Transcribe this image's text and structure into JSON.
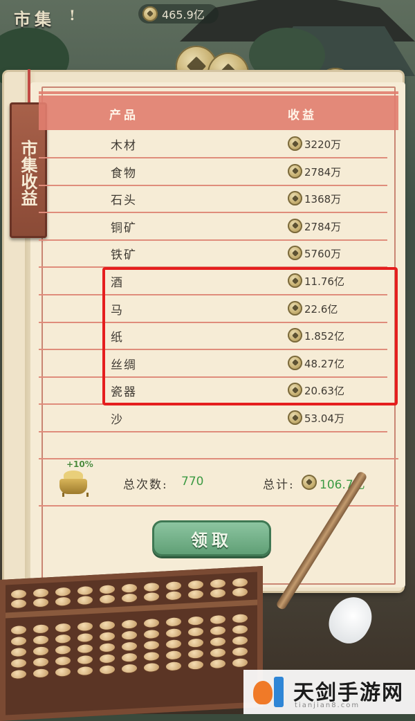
{
  "top": {
    "title": "市集",
    "help": "!",
    "currency": "465.9亿"
  },
  "tag": {
    "label": "市集收益"
  },
  "table": {
    "header_product": "产品",
    "header_income": "收益",
    "rows": [
      {
        "name": "木材",
        "value": "3220万"
      },
      {
        "name": "食物",
        "value": "2784万"
      },
      {
        "name": "石头",
        "value": "1368万"
      },
      {
        "name": "铜矿",
        "value": "2784万"
      },
      {
        "name": "铁矿",
        "value": "5760万"
      },
      {
        "name": "酒",
        "value": "11.76亿"
      },
      {
        "name": "马",
        "value": "22.6亿"
      },
      {
        "name": "纸",
        "value": "1.852亿"
      },
      {
        "name": "丝绸",
        "value": "48.27亿"
      },
      {
        "name": "瓷器",
        "value": "20.63亿"
      },
      {
        "name": "沙",
        "value": "53.04万"
      }
    ]
  },
  "summary": {
    "bonus": "+10%",
    "count_label": "总次数:",
    "count_value": "770",
    "total_label": "总计:",
    "total_value": "106.7亿"
  },
  "button": {
    "claim": "领取"
  },
  "watermark": {
    "title": "天剑手游网",
    "sub": "tianjian8.com"
  },
  "colors": {
    "accent_red": "#e27f70",
    "highlight": "#e51e1e",
    "green": "#3c9a43"
  }
}
